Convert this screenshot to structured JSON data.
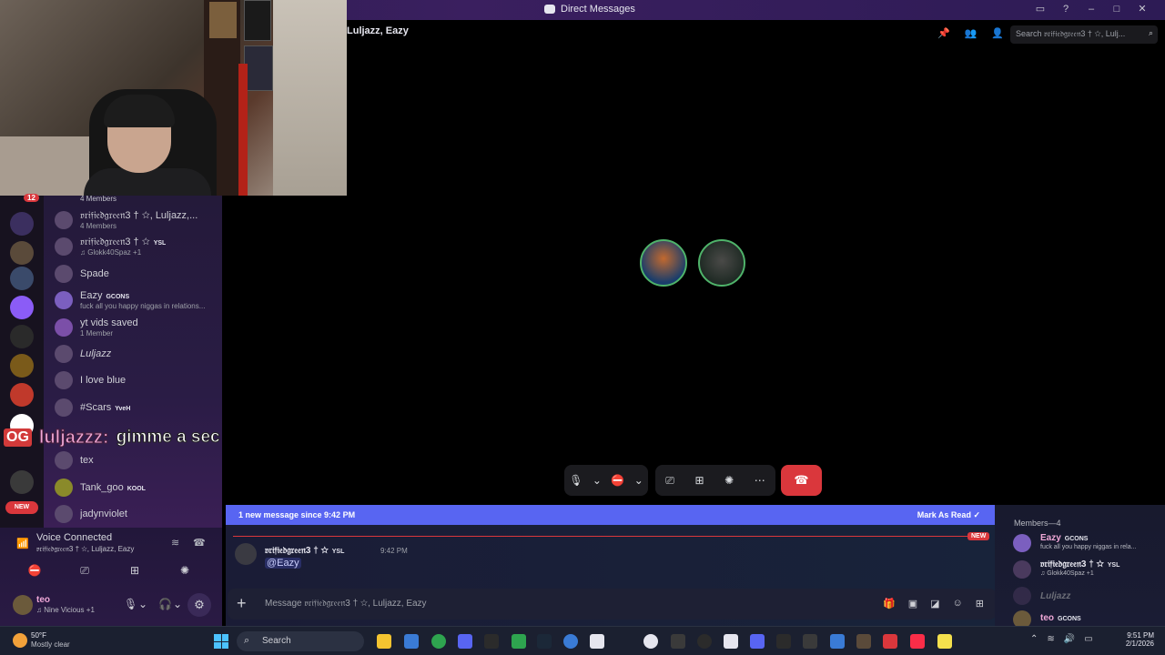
{
  "window": {
    "title": "Direct Messages",
    "call_header": "Luljazz, Eazy"
  },
  "search": {
    "placeholder": "Search 𝔳𝔯𝔦𝔣𝔦𝔢𝔡𝔤𝔯𝔢𝔢𝔫3 † ☆, Lulj..."
  },
  "sidebar": {
    "unread_badge": "12",
    "top_members": "4 Members",
    "dms": [
      {
        "name": "𝔳𝔯𝔦𝔣𝔦𝔢𝔡𝔤𝔯𝔢𝔢𝔫3 † ☆, Luljazz,...",
        "sub": "4 Members",
        "tag": ""
      },
      {
        "name": "𝔳𝔯𝔦𝔣𝔦𝔢𝔡𝔤𝔯𝔢𝔢𝔫3 † ☆",
        "sub": "♫ Glokk40Spaz +1",
        "tag": "YSL"
      },
      {
        "name": "Spade",
        "sub": "",
        "tag": ""
      },
      {
        "name": "Eazy",
        "sub": "fuck all you happy niggas in relations...",
        "tag": "GCONS"
      },
      {
        "name": "yt vids saved",
        "sub": "1 Member",
        "tag": ""
      },
      {
        "name": "Luljazz",
        "sub": "",
        "tag": ""
      },
      {
        "name": "I love blue",
        "sub": "",
        "tag": ""
      },
      {
        "name": "#Scars",
        "sub": "",
        "tag": "YveH"
      },
      {
        "name": "tex",
        "sub": "",
        "tag": ""
      },
      {
        "name": "Tank_goo",
        "sub": "",
        "tag": "KOOL"
      },
      {
        "name": "jadynviolet",
        "sub": "",
        "tag": ""
      }
    ]
  },
  "stream_caption": {
    "badge": "OG",
    "user": "luljazzz:",
    "message": "gimme a sec"
  },
  "voice": {
    "status": "Voice Connected",
    "channel": "𝔳𝔯𝔦𝔣𝔦𝔢𝔡𝔤𝔯𝔢𝔢𝔫3 † ☆, Luljazz, Eazy"
  },
  "user_panel": {
    "name": "teo",
    "status": "♫ Nine Vicious +1"
  },
  "chat": {
    "new_banner": "1 new message since 9:42 PM",
    "mark_read": "Mark As Read",
    "new_tag": "NEW",
    "message": {
      "author": "𝔳𝔯𝔦𝔣𝔦𝔢𝔡𝔤𝔯𝔢𝔢𝔫3 † ☆",
      "tag": "YSL",
      "time": "9:42 PM",
      "text": "@Eazy"
    },
    "composer_placeholder": "Message 𝔳𝔯𝔦𝔣𝔦𝔢𝔡𝔤𝔯𝔢𝔢𝔫3 † ☆, Luljazz, Eazy"
  },
  "members": {
    "header": "Members—4",
    "list": [
      {
        "name": "Eazy",
        "tag": "GCONS",
        "sub": "fuck all you happy niggas in rela...",
        "color": "#f0a8d8"
      },
      {
        "name": "𝔳𝔯𝔦𝔣𝔦𝔢𝔡𝔤𝔯𝔢𝔢𝔫3 † ☆",
        "tag": "YSL",
        "sub": "♫ Glokk40Spaz +1",
        "color": "#e6e6ef"
      },
      {
        "name": "Luljazz",
        "tag": "",
        "sub": "",
        "color": "#6d6f78"
      },
      {
        "name": "teo",
        "tag": "GCONS",
        "sub": "",
        "color": "#f0a8d8"
      }
    ]
  },
  "taskbar": {
    "weather_temp": "50°F",
    "weather_cond": "Mostly clear",
    "search_label": "Search",
    "time": "9:51 PM",
    "date": "2/1/2026"
  },
  "colors": {
    "accent": "#5865f2",
    "danger": "#da373c",
    "speaking": "#4fb36a"
  }
}
